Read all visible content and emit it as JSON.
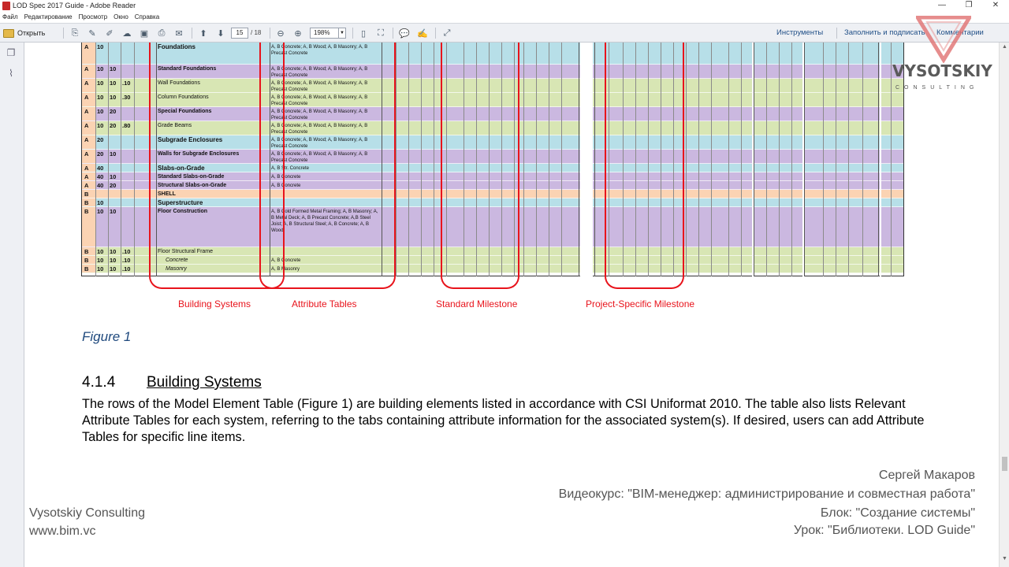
{
  "window": {
    "title": "LOD Spec 2017 Guide - Adobe Reader",
    "buttons": [
      "—",
      "❐",
      "✕"
    ]
  },
  "menu": [
    "Файл",
    "Редактирование",
    "Просмотр",
    "Окно",
    "Справка"
  ],
  "toolbar": {
    "open_label": "Открыть",
    "page_current": "15",
    "page_total": "/ 18",
    "zoom": "198%",
    "tools_label": "Инструменты",
    "fill_sign_label": "Заполнить и подписать",
    "comments_label": "Комментарии"
  },
  "table": {
    "rows": [
      {
        "a": "A",
        "b": "10",
        "c": "",
        "d": "",
        "name": "Foundations",
        "style": "big",
        "attr": "A, B Concrete; A, B Wood; A, B Masonry; A, B Precast Concrete",
        "color": "#b7dfe8"
      },
      {
        "a": "A",
        "b": "10",
        "c": "10",
        "d": "",
        "name": "Standard Foundations",
        "style": "bold",
        "attr": "A, B Concrete; A, B Wood; A, B Masonry; A, B Precast Concrete",
        "color": "#cbb8e0"
      },
      {
        "a": "A",
        "b": "10",
        "c": "10",
        "d": ".10",
        "name": "Wall Foundations",
        "style": "",
        "attr": "A, B Concrete; A, B Wood; A, B Masonry; A, B Precast Concrete",
        "color": "#d8e6b4"
      },
      {
        "a": "A",
        "b": "10",
        "c": "10",
        "d": ".30",
        "name": "Column Foundations",
        "style": "",
        "attr": "A, B Concrete; A, B Wood; A, B Masonry; A, B Precast Concrete",
        "color": "#d8e6b4"
      },
      {
        "a": "A",
        "b": "10",
        "c": "20",
        "d": "",
        "name": "Special Foundations",
        "style": "bold",
        "attr": "A, B Concrete; A, B Wood; A, B Masonry; A, B Precast Concrete",
        "color": "#cbb8e0"
      },
      {
        "a": "A",
        "b": "10",
        "c": "20",
        "d": ".80",
        "name": "Grade Beams",
        "style": "",
        "attr": "A, B Concrete; A, B Wood; A, B Masonry; A, B Precast Concrete",
        "color": "#d8e6b4"
      },
      {
        "a": "A",
        "b": "20",
        "c": "",
        "d": "",
        "name": "Subgrade Enclosures",
        "style": "big",
        "attr": "A, B Concrete; A, B Wood; A, B Masonry; A, B Precast Concrete",
        "color": "#b7dfe8"
      },
      {
        "a": "A",
        "b": "20",
        "c": "10",
        "d": "",
        "name": "Walls for Subgrade Enclosures",
        "style": "bold",
        "attr": "A, B Concrete; A, B Wood; A, B Masonry; A, B Precast Concrete",
        "color": "#cbb8e0"
      },
      {
        "a": "A",
        "b": "40",
        "c": "",
        "d": "",
        "name": "Slabs-on-Grade",
        "style": "big",
        "attr": "A, B Str. Concrete",
        "color": "#b7dfe8"
      },
      {
        "a": "A",
        "b": "40",
        "c": "10",
        "d": "",
        "name": "Standard Slabs-on-Grade",
        "style": "bold",
        "attr": "A, B Concrete",
        "color": "#cbb8e0"
      },
      {
        "a": "A",
        "b": "40",
        "c": "20",
        "d": "",
        "name": "Structural Slabs-on-Grade",
        "style": "bold",
        "attr": "A, B Concrete",
        "color": "#cbb8e0"
      },
      {
        "a": "B",
        "b": "",
        "c": "",
        "d": "",
        "name": "SHELL",
        "style": "bold",
        "attr": "",
        "color": "#fbd3b3"
      },
      {
        "a": "B",
        "b": "10",
        "c": "",
        "d": "",
        "name": "Superstructure",
        "style": "big",
        "attr": "",
        "color": "#b7dfe8"
      },
      {
        "a": "B",
        "b": "10",
        "c": "10",
        "d": "",
        "name": "Floor Construction",
        "style": "bold",
        "attr": "A, B Cold Formed Metal Framing; A, B Masonry; A, B Metal Deck; A, B Precast Concrete; A,B Steel Joist; A, B Structural Steel; A, B Concrete; A, B Wood",
        "color": "#cbb8e0"
      },
      {
        "a": "B",
        "b": "10",
        "c": "10",
        "d": ".10",
        "name": "Floor Structural Frame",
        "style": "",
        "attr": "",
        "color": "#d8e6b4"
      },
      {
        "a": "B",
        "b": "10",
        "c": "10",
        "d": ".10",
        "name": "Concrete",
        "style": "ind",
        "attr": "A, B Concrete",
        "color": "#d8e6b4"
      },
      {
        "a": "B",
        "b": "10",
        "c": "10",
        "d": ".10",
        "name": "Masonry",
        "style": "ind",
        "attr": "A, B Masonry",
        "color": "#d8e6b4"
      }
    ],
    "labels": {
      "building_systems": "Building Systems",
      "attribute_tables": "Attribute Tables",
      "standard_milestone": "Standard Milestone",
      "project_milestone": "Project-Specific Milestone"
    }
  },
  "doc": {
    "figure_caption": "Figure 1",
    "section_number": "4.1.4",
    "section_title": "Building Systems",
    "paragraph": "The rows of the Model Element Table (Figure 1) are building elements listed in accordance with CSI Uniformat 2010. The table also lists Relevant Attribute Tables for each system, referring to the tabs containing attribute information for the associated system(s). If desired, users can add Attribute Tables for specific line items."
  },
  "overlay": {
    "author": "Сергей Макаров",
    "course": "Видеокурс: \"BIM-менеджер: администрирование и совместная работа\"",
    "block": "Блок: \"Создание системы\"",
    "lesson": "Урок: \"Библиотеки. LOD Guide\"",
    "company": "Vysotskiy Consulting",
    "site": "www.bim.vc",
    "logo_word": "VYSOTSKIY",
    "logo_sub": "CONSULTING"
  }
}
